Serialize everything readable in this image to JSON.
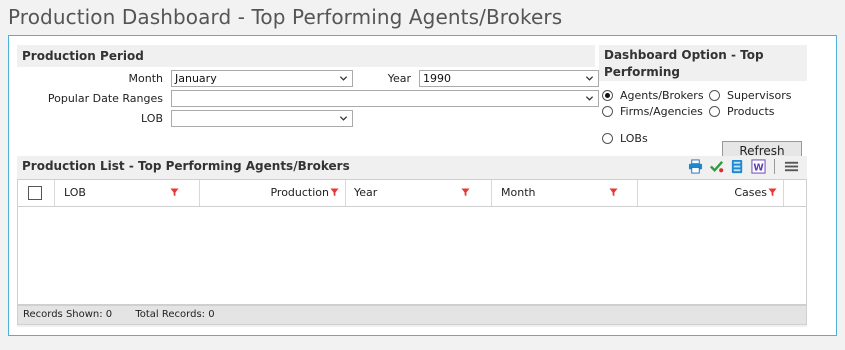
{
  "page": {
    "title": "Production Dashboard - Top Performing Agents/Brokers"
  },
  "period": {
    "title": "Production Period",
    "month_label": "Month",
    "month_value": "January",
    "year_label": "Year",
    "year_value": "1990",
    "ranges_label": "Popular Date Ranges",
    "ranges_value": "",
    "lob_label": "LOB",
    "lob_value": ""
  },
  "options": {
    "title": "Dashboard Option - Top Performing",
    "radios": [
      {
        "label": "Agents/Brokers",
        "checked": true
      },
      {
        "label": "Supervisors",
        "checked": false
      },
      {
        "label": "Firms/Agencies",
        "checked": false
      },
      {
        "label": "Products",
        "checked": false
      },
      {
        "label": "LOBs",
        "checked": false
      }
    ],
    "refresh_label": "Refresh"
  },
  "list": {
    "title": "Production List - Top Performing Agents/Brokers",
    "columns": [
      "LOB",
      "Production",
      "Year",
      "Month",
      "Cases"
    ],
    "footer": {
      "records_shown": "Records Shown: 0",
      "total_records": "Total Records: 0"
    }
  },
  "colors": {
    "accent_border": "#4fb0d8",
    "filter_red": "#e53935"
  },
  "icons": [
    "printer-icon",
    "checkmark-icon",
    "export-icon",
    "word-icon",
    "menu-icon",
    "filter-icon",
    "chevron-down-icon"
  ]
}
